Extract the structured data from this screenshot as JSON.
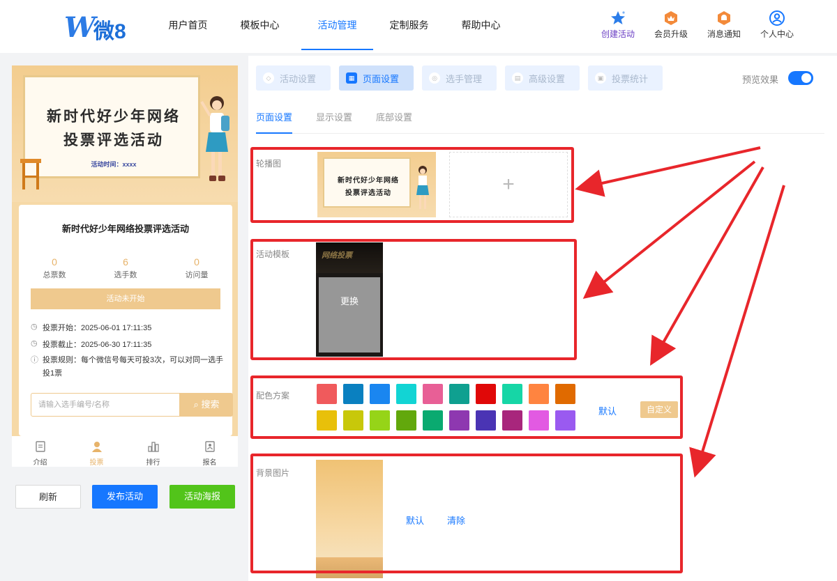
{
  "brand": {
    "logo_text": "微8"
  },
  "nav": [
    {
      "label": "用户首页"
    },
    {
      "label": "模板中心"
    },
    {
      "label": "活动管理"
    },
    {
      "label": "定制服务"
    },
    {
      "label": "帮助中心"
    }
  ],
  "quick": [
    {
      "label": "创建活动",
      "icon": "star-icon"
    },
    {
      "label": "会员升级",
      "icon": "crown-badge-icon"
    },
    {
      "label": "消息通知",
      "icon": "bell-badge-icon"
    },
    {
      "label": "个人中心",
      "icon": "user-circle-icon"
    }
  ],
  "preview": {
    "banner_title_line1": "新时代好少年网络",
    "banner_title_line2": "投票评选活动",
    "banner_time": "活动时间：xxxx",
    "title": "新时代好少年网络投票评选活动",
    "stats": [
      {
        "value": "0",
        "label": "总票数"
      },
      {
        "value": "6",
        "label": "选手数"
      },
      {
        "value": "0",
        "label": "访问量"
      }
    ],
    "status": "活动未开始",
    "vote_start": "投票开始：2025-06-01 17:11:35",
    "vote_end": "投票截止：2025-06-30 17:11:35",
    "vote_rule": "投票规则：每个微信号每天可投3次，可以对同一选手投1票",
    "search_placeholder": "请输入选手编号/名称",
    "search_button": "搜索",
    "tabs": [
      {
        "label": "介绍"
      },
      {
        "label": "投票"
      },
      {
        "label": "排行"
      },
      {
        "label": "报名"
      }
    ]
  },
  "actions": {
    "refresh": "刷新",
    "publish": "发布活动",
    "poster": "活动海报"
  },
  "settings": {
    "tabs": [
      {
        "label": "活动设置"
      },
      {
        "label": "页面设置"
      },
      {
        "label": "选手管理"
      },
      {
        "label": "高级设置"
      },
      {
        "label": "投票统计"
      }
    ],
    "preview_label": "预览效果",
    "preview_enabled": true,
    "subtabs": [
      {
        "label": "页面设置"
      },
      {
        "label": "显示设置"
      },
      {
        "label": "底部设置"
      }
    ],
    "carousel_label": "轮播图",
    "template_label": "活动模板",
    "template_change": "更换",
    "color_label": "配色方案",
    "colors": [
      "#f05a5c",
      "#0a80c0",
      "#1a86f0",
      "#12d4d4",
      "#e85f96",
      "#0fa090",
      "#e00808",
      "#16d6a6",
      "#ff8440",
      "#e06a00",
      "#e8c00a",
      "#c8c80a",
      "#96d418",
      "#62a80c",
      "#0aaa70",
      "#8e38b0",
      "#4a34b4",
      "#a8267c",
      "#e25ae2",
      "#9a5af0"
    ],
    "color_default": "默认",
    "color_custom": "自定义",
    "bg_label": "背景图片",
    "bg_default": "默认",
    "bg_clear": "清除"
  }
}
